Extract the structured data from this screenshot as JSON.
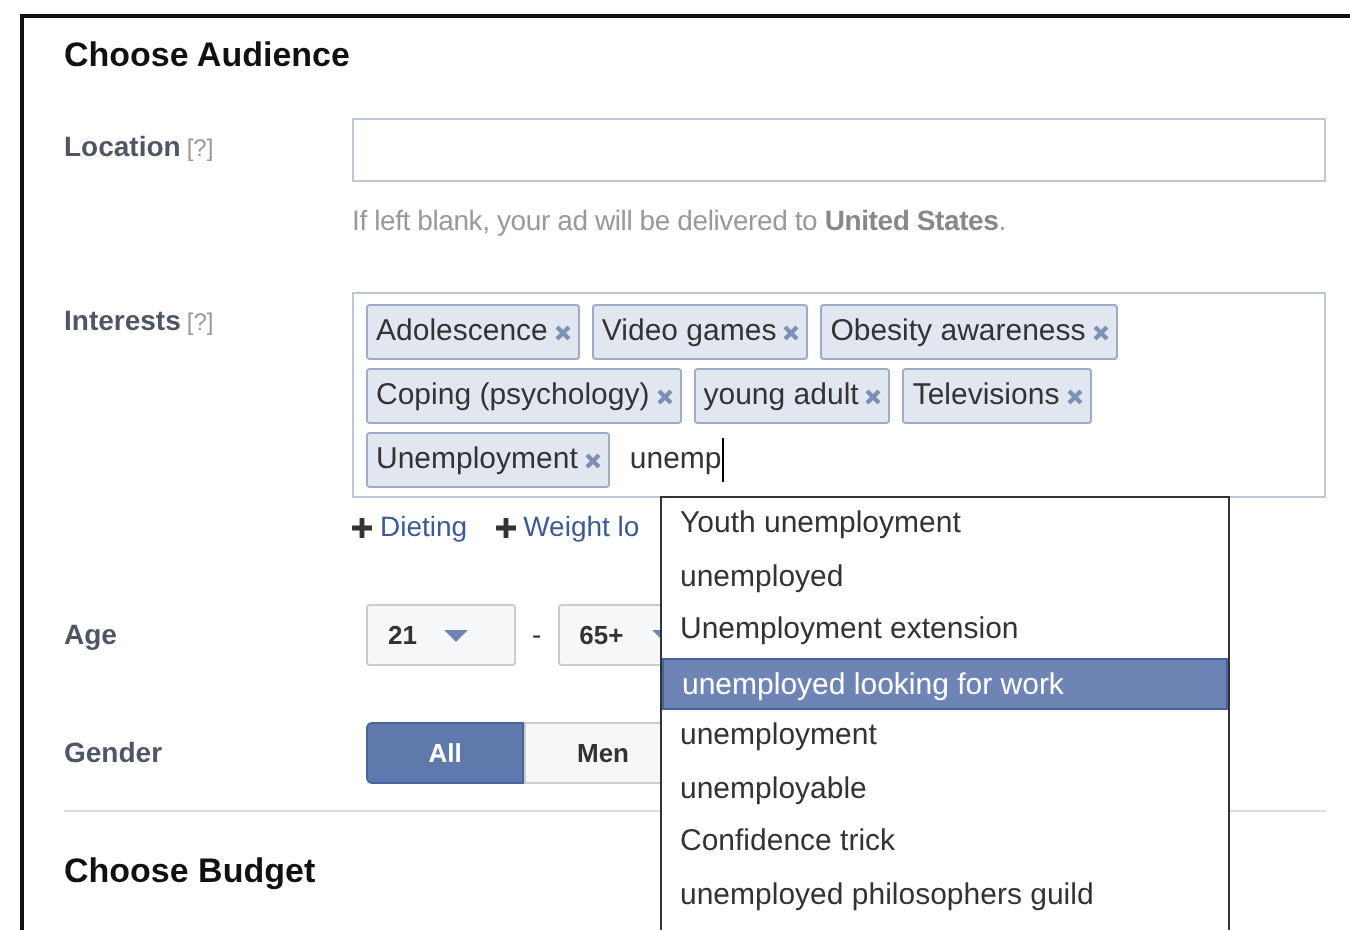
{
  "audience": {
    "title": "Choose Audience",
    "location": {
      "label": "Location",
      "help": "[?]",
      "hint": "If left blank, your ad will be delivered to **United States**."
    },
    "interests": {
      "label": "Interests",
      "help": "[?]",
      "tags": [
        "Adolescence",
        "Video games",
        "Obesity awareness",
        "Coping (psychology)",
        "young adult",
        "Televisions",
        "Unemployment"
      ],
      "query": "unemp",
      "suggestions": [
        "Dieting",
        "Weight lo"
      ],
      "dropdown": [
        {
          "label": "Youth unemployment",
          "selected": false
        },
        {
          "label": "unemployed",
          "selected": false
        },
        {
          "label": "Unemployment extension",
          "selected": false
        },
        {
          "label": "unemployed looking for work",
          "selected": true
        },
        {
          "label": "unemployment",
          "selected": false
        },
        {
          "label": "unemployable",
          "selected": false
        },
        {
          "label": "Confidence trick",
          "selected": false
        },
        {
          "label": "unemployed philosophers guild",
          "selected": false
        }
      ]
    },
    "age": {
      "label": "Age",
      "min": "21",
      "separator": "-",
      "max": "65+"
    },
    "gender": {
      "label": "Gender",
      "options": [
        {
          "label": "All",
          "selected": true
        },
        {
          "label": "Men",
          "selected": false
        }
      ]
    }
  },
  "budget": {
    "title": "Choose Budget"
  }
}
